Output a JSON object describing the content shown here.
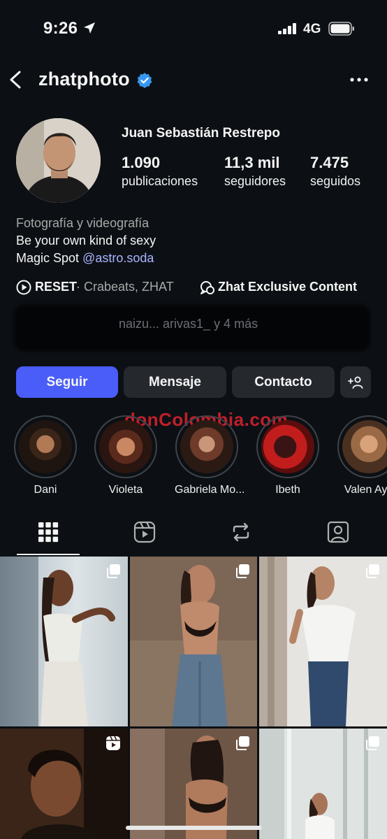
{
  "status_bar": {
    "time": "9:26",
    "network": "4G"
  },
  "header": {
    "username": "zhatphoto"
  },
  "profile": {
    "full_name": "Juan Sebastián Restrepo",
    "stats": [
      {
        "value": "1.090",
        "label": "publicaciones"
      },
      {
        "value": "11,3 mil",
        "label": "seguidores"
      },
      {
        "value": "7.475",
        "label": "seguidos"
      }
    ],
    "category": "Fotografía y videografía",
    "bio_line1": "Be your own kind of sexy",
    "bio_line2_prefix": "Magic Spot ",
    "bio_mention": "@astro.soda",
    "link1_title": "RESET",
    "link1_sub": "· Crabeats, ZHAT",
    "link2_title": "Zhat Exclusive Content",
    "followed_by": "naizu... arivas1_ y 4 más"
  },
  "buttons": {
    "follow": "Seguir",
    "message": "Mensaje",
    "contact": "Contacto"
  },
  "watermark": "donColombia.com",
  "highlights": [
    {
      "name": "Dani"
    },
    {
      "name": "Violeta"
    },
    {
      "name": "Gabriela Mo..."
    },
    {
      "name": "Ibeth"
    },
    {
      "name": "Valen Aya"
    }
  ],
  "colors": {
    "accent": "#4a5df9",
    "background": "#0c1014",
    "button": "#25292e",
    "mention": "#aab4ff"
  }
}
